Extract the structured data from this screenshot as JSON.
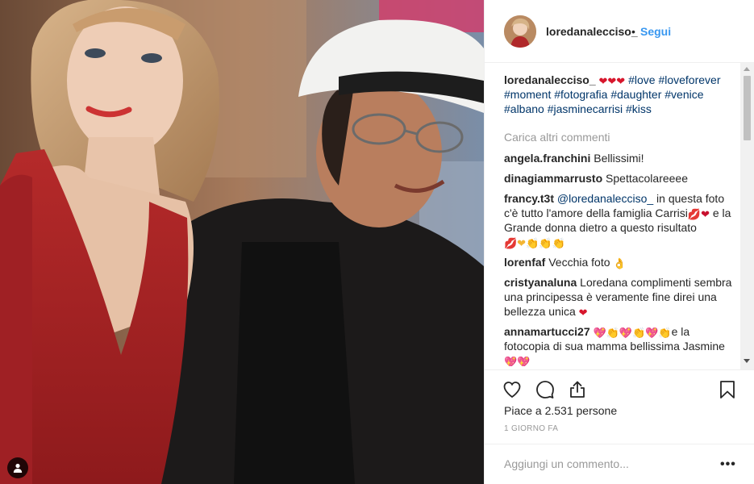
{
  "header": {
    "username": "loredanalecciso_",
    "separator": "•",
    "follow_label": "Segui"
  },
  "caption": {
    "username": "loredanalecciso_",
    "emoji": "❤❤❤",
    "hashtags": [
      "#love",
      "#loveforever",
      "#moment",
      "#fotografia",
      "#daughter",
      "#venice",
      "#albano",
      "#jasminecarrisi",
      "#kiss"
    ]
  },
  "load_more": "Carica altri commenti",
  "comments": [
    {
      "user": "angela.franchini",
      "text": "Bellissimi!"
    },
    {
      "user": "dinagiammarrusto",
      "text": "Spettacolareeee"
    },
    {
      "user": "francy.t3t",
      "mention": "@loredanalecciso_",
      "text1": " in questa foto c'è tutto l'amore della famiglia Carrisi",
      "emoji1": "💋❤",
      "text2": " e la Grande donna dietro a questo risultato ",
      "emoji2": "💋❤👏👏👏"
    },
    {
      "user": "lorenfaf",
      "text": "Vecchia foto",
      "emoji": "👌"
    },
    {
      "user": "cristyanaluna",
      "text": "Loredana complimenti sembra una principessa è veramente fine direi una bellezza unica",
      "emoji": "❤"
    },
    {
      "user": "annamartucci27",
      "emoji": "💖👏💖👏💖👏",
      "text": "e la fotocopia di sua mamma bellissima Jasmine",
      "emoji2": "💖💖"
    }
  ],
  "actions": {
    "like_icon": "heart-outline-icon",
    "comment_icon": "comment-bubble-icon",
    "share_icon": "share-icon",
    "save_icon": "bookmark-icon"
  },
  "likes_text": "Piace a 2.531 persone",
  "timestamp": "1 GIORNO FA",
  "add_comment": {
    "placeholder": "Aggiungi un commento...",
    "more_label": "•••"
  },
  "colors": {
    "link": "#3897f0",
    "hashtag": "#003569",
    "muted": "#999999",
    "border": "#efefef"
  }
}
